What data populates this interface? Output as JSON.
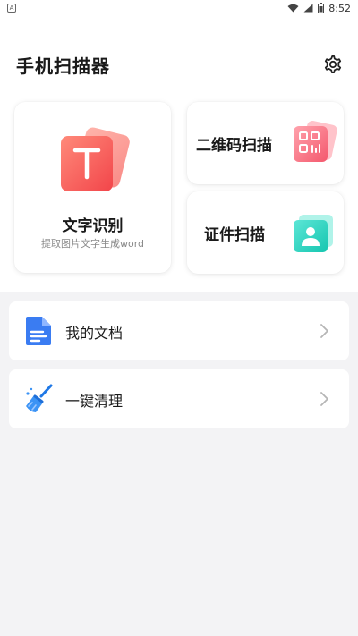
{
  "status_bar": {
    "app_indicator": "A",
    "time": "8:52",
    "icons": [
      "notification-a-icon",
      "wifi-icon",
      "signal-icon",
      "battery-icon"
    ]
  },
  "header": {
    "title": "手机扫描器",
    "settings_icon": "gear-icon"
  },
  "cards": {
    "ocr": {
      "icon_letter": "T",
      "title": "文字识别",
      "subtitle": "提取图片文字生成word",
      "accent": "#f0524f"
    },
    "qr": {
      "label": "二维码扫描",
      "accent": "#f7657a"
    },
    "id": {
      "label": "证件扫描",
      "accent": "#23d4c2"
    }
  },
  "list": {
    "docs": {
      "label": "我的文档",
      "icon": "document-icon",
      "accent": "#3a7cf2"
    },
    "clean": {
      "label": "一键清理",
      "icon": "broom-icon",
      "accent": "#2f8ff0"
    }
  }
}
